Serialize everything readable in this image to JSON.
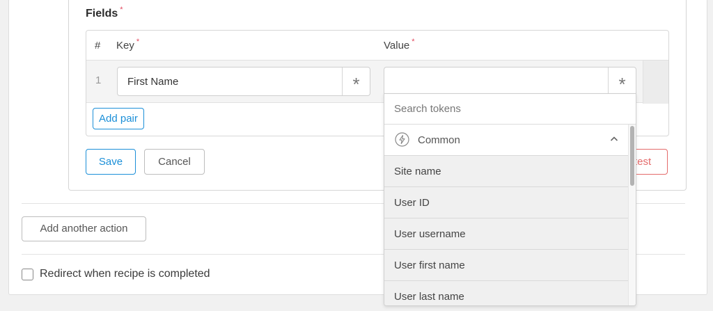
{
  "fields": {
    "title": "Fields",
    "required_mark": "*",
    "columns": {
      "hash": "#",
      "key": "Key",
      "value": "Value"
    },
    "rows": [
      {
        "index": "1",
        "key": "First Name",
        "value": ""
      }
    ],
    "token_glyph": "*",
    "add_pair_label": "Add pair"
  },
  "actions": {
    "save_label": "Save",
    "cancel_label": "Cancel",
    "test_label": "test"
  },
  "add_action_label": "Add another action",
  "redirect": {
    "label": "Redirect when recipe is completed",
    "checked": false
  },
  "token_dropdown": {
    "search_placeholder": "Search tokens",
    "group": {
      "label": "Common",
      "icon": "bolt-icon",
      "expanded": true
    },
    "items": [
      "Site name",
      "User ID",
      "User username",
      "User first name",
      "User last name"
    ]
  },
  "colors": {
    "accent": "#1b8fd8",
    "required": "#e2485e",
    "danger": "#e46b6b"
  }
}
